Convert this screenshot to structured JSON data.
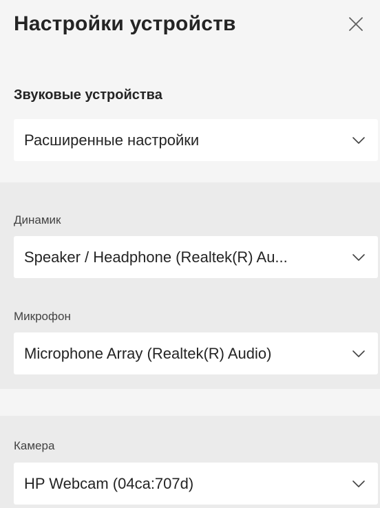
{
  "header": {
    "title": "Настройки устройств",
    "close_icon": "close-icon"
  },
  "audio": {
    "section_title": "Звуковые устройства",
    "preset": {
      "value": "Расширенные настройки",
      "icon": "chevron-down-icon"
    }
  },
  "speaker": {
    "label": "Динамик",
    "value": "Speaker / Headphone (Realtek(R) Au...",
    "icon": "chevron-down-icon"
  },
  "microphone": {
    "label": "Микрофон",
    "value": "Microphone Array (Realtek(R) Audio)",
    "icon": "chevron-down-icon"
  },
  "camera": {
    "label": "Камера",
    "value": "HP Webcam (04ca:707d)",
    "icon": "chevron-down-icon"
  },
  "colors": {
    "panel_bg": "#f5f5f5",
    "band_bg": "#ebebeb",
    "field_bg": "#ffffff",
    "text": "#242424"
  }
}
